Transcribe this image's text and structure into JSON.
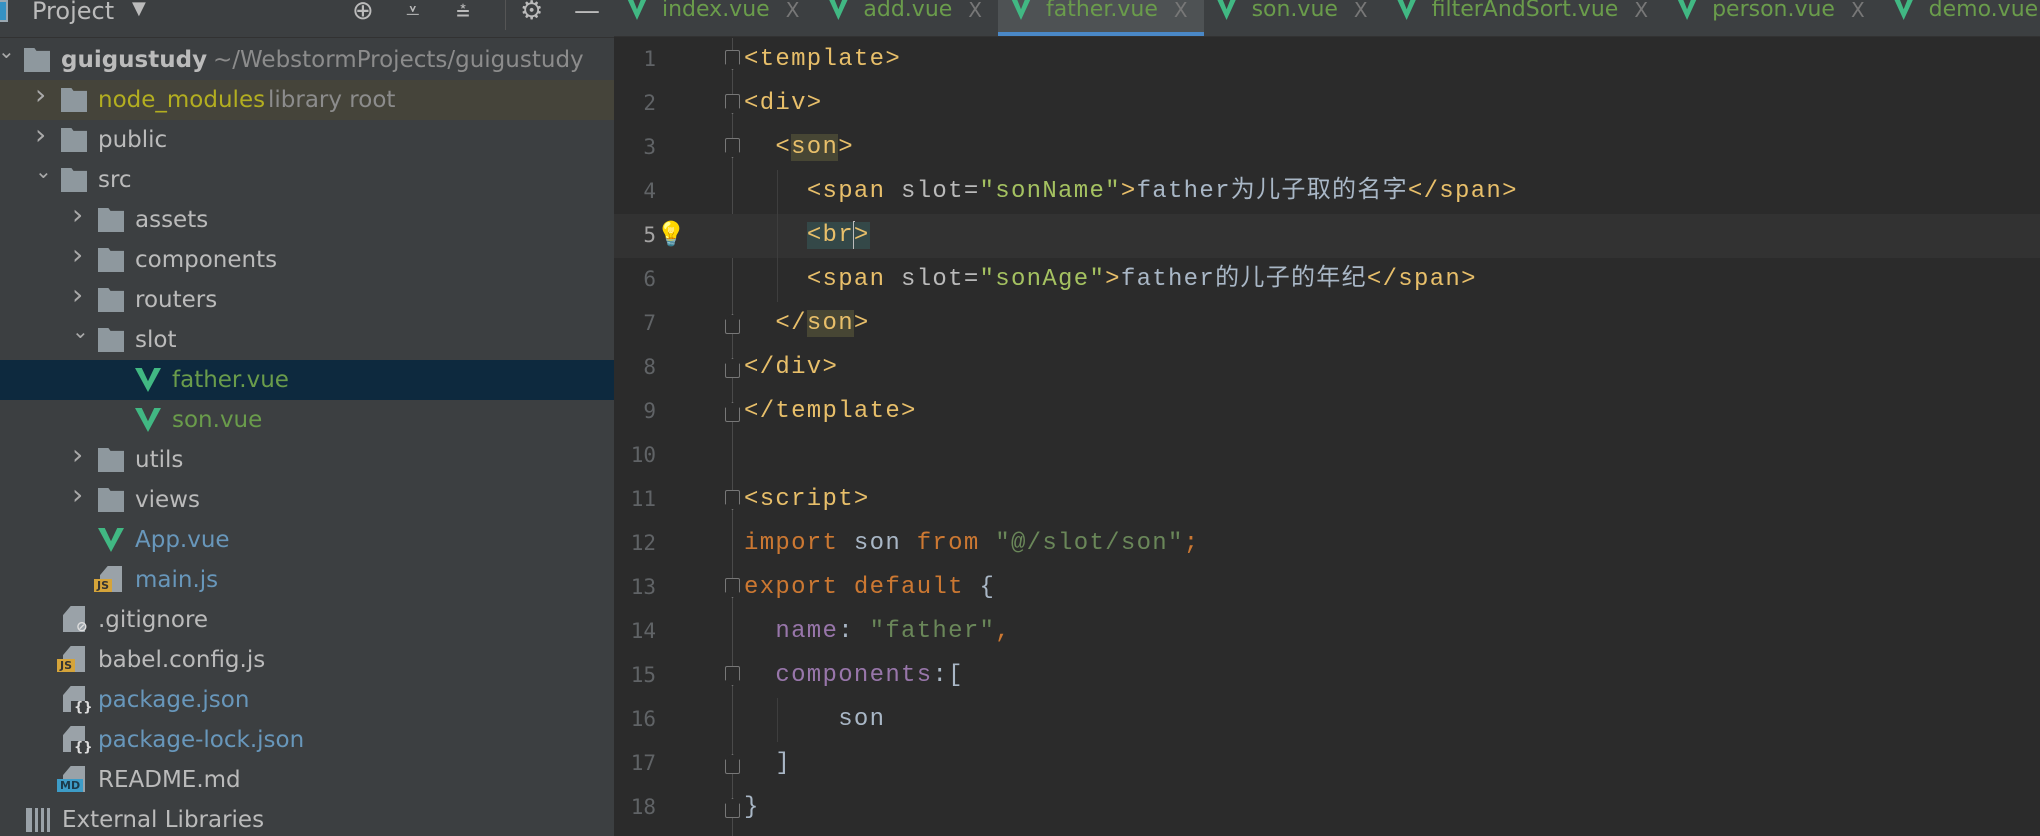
{
  "sidebar": {
    "title": "Project",
    "toolbar_icons": [
      "locate-icon",
      "expand-all-icon",
      "collapse-all-icon",
      "gear-icon",
      "hide-icon"
    ],
    "items": [
      {
        "label": "guigustudy",
        "hint": "~/WebstormProjects/guigustudy",
        "depth": 0,
        "kind": "folder",
        "expanded": true,
        "bold": true
      },
      {
        "label": "node_modules",
        "hint": "library root",
        "depth": 1,
        "kind": "folder",
        "expanded": false,
        "color": "yellow",
        "state": "library"
      },
      {
        "label": "public",
        "depth": 1,
        "kind": "folder",
        "expanded": false
      },
      {
        "label": "src",
        "depth": 1,
        "kind": "folder",
        "expanded": true
      },
      {
        "label": "assets",
        "depth": 2,
        "kind": "folder",
        "expanded": false
      },
      {
        "label": "components",
        "depth": 2,
        "kind": "folder",
        "expanded": false
      },
      {
        "label": "routers",
        "depth": 2,
        "kind": "folder",
        "expanded": false
      },
      {
        "label": "slot",
        "depth": 2,
        "kind": "folder",
        "expanded": true
      },
      {
        "label": "father.vue",
        "depth": 3,
        "kind": "vue",
        "color": "green",
        "state": "selected"
      },
      {
        "label": "son.vue",
        "depth": 3,
        "kind": "vue",
        "color": "green"
      },
      {
        "label": "utils",
        "depth": 2,
        "kind": "folder",
        "expanded": false
      },
      {
        "label": "views",
        "depth": 2,
        "kind": "folder",
        "expanded": false
      },
      {
        "label": "App.vue",
        "depth": 2,
        "kind": "vue",
        "color": "blue"
      },
      {
        "label": "main.js",
        "depth": 2,
        "kind": "js",
        "color": "blue",
        "badge": "JS"
      },
      {
        "label": ".gitignore",
        "depth": 1,
        "kind": "ignore"
      },
      {
        "label": "babel.config.js",
        "depth": 1,
        "kind": "js",
        "badge": "JS"
      },
      {
        "label": "package.json",
        "depth": 1,
        "kind": "json",
        "color": "blue"
      },
      {
        "label": "package-lock.json",
        "depth": 1,
        "kind": "json",
        "color": "blue"
      },
      {
        "label": "README.md",
        "depth": 1,
        "kind": "md",
        "badge": "MD"
      },
      {
        "label": "External Libraries",
        "depth": 0,
        "kind": "libs"
      }
    ]
  },
  "tabs": [
    {
      "label": "index.vue"
    },
    {
      "label": "add.vue"
    },
    {
      "label": "father.vue",
      "active": true
    },
    {
      "label": "son.vue"
    },
    {
      "label": "filterAndSort.vue"
    },
    {
      "label": "person.vue"
    },
    {
      "label": "demo.vue"
    }
  ],
  "tab_close": "X",
  "editor": {
    "current_line": 5,
    "lines": [
      {
        "n": "1",
        "fold": "open",
        "tokens": [
          [
            "tag",
            "<template>"
          ]
        ]
      },
      {
        "n": "2",
        "fold": "open",
        "tokens": [
          [
            "tag",
            "<div>"
          ]
        ]
      },
      {
        "n": "3",
        "fold": "open",
        "tokens": [
          [
            "plain",
            "  "
          ],
          [
            "tag",
            "<"
          ],
          [
            "tag hl",
            "son"
          ],
          [
            "tag",
            ">"
          ]
        ]
      },
      {
        "n": "4",
        "tokens": [
          [
            "plain",
            "    "
          ],
          [
            "tag",
            "<span "
          ],
          [
            "attr",
            "slot="
          ],
          [
            "val",
            "\"sonName\""
          ],
          [
            "tag",
            ">"
          ],
          [
            "text",
            "father为儿子取的名字"
          ],
          [
            "tag",
            "</span>"
          ]
        ]
      },
      {
        "n": "5",
        "bulb": true,
        "tokens": [
          [
            "plain",
            "    "
          ],
          [
            "tag hlbr",
            "<br"
          ],
          [
            "caret",
            ""
          ],
          [
            "tag hlbr",
            ">"
          ]
        ]
      },
      {
        "n": "6",
        "tokens": [
          [
            "plain",
            "    "
          ],
          [
            "tag",
            "<span "
          ],
          [
            "attr",
            "slot="
          ],
          [
            "val",
            "\"sonAge\""
          ],
          [
            "tag",
            ">"
          ],
          [
            "text",
            "father的儿子的年纪"
          ],
          [
            "tag",
            "</span>"
          ]
        ]
      },
      {
        "n": "7",
        "fold": "close",
        "tokens": [
          [
            "plain",
            "  "
          ],
          [
            "tag",
            "</"
          ],
          [
            "tag hl",
            "son"
          ],
          [
            "tag",
            ">"
          ]
        ]
      },
      {
        "n": "8",
        "fold": "close",
        "tokens": [
          [
            "tag",
            "</div>"
          ]
        ]
      },
      {
        "n": "9",
        "fold": "close",
        "tokens": [
          [
            "tag",
            "</template>"
          ]
        ]
      },
      {
        "n": "10",
        "tokens": []
      },
      {
        "n": "11",
        "fold": "open",
        "tokens": [
          [
            "tag",
            "<script>"
          ]
        ]
      },
      {
        "n": "12",
        "tokens": [
          [
            "kw",
            "import "
          ],
          [
            "plain",
            "son "
          ],
          [
            "kw",
            "from "
          ],
          [
            "str",
            "\"@/slot/son\""
          ],
          [
            "punc",
            ";"
          ]
        ]
      },
      {
        "n": "13",
        "fold": "open",
        "tokens": [
          [
            "kw",
            "export default "
          ],
          [
            "plain",
            "{"
          ]
        ]
      },
      {
        "n": "14",
        "tokens": [
          [
            "plain",
            "  "
          ],
          [
            "prop",
            "name"
          ],
          [
            "plain",
            ": "
          ],
          [
            "str",
            "\"father\""
          ],
          [
            "punc",
            ","
          ]
        ]
      },
      {
        "n": "15",
        "fold": "open",
        "tokens": [
          [
            "plain",
            "  "
          ],
          [
            "prop",
            "components"
          ],
          [
            "plain",
            ":["
          ]
        ]
      },
      {
        "n": "16",
        "tokens": [
          [
            "plain",
            "      son"
          ]
        ]
      },
      {
        "n": "17",
        "fold": "close",
        "tokens": [
          [
            "plain",
            "  ]"
          ]
        ]
      },
      {
        "n": "18",
        "fold": "close",
        "tokens": [
          [
            "plain",
            "}"
          ]
        ]
      }
    ]
  },
  "colors": {
    "accent": "#4a88c7",
    "vue": "#41b883",
    "selected_row": "#0d293e",
    "library_row": "#45443a"
  }
}
